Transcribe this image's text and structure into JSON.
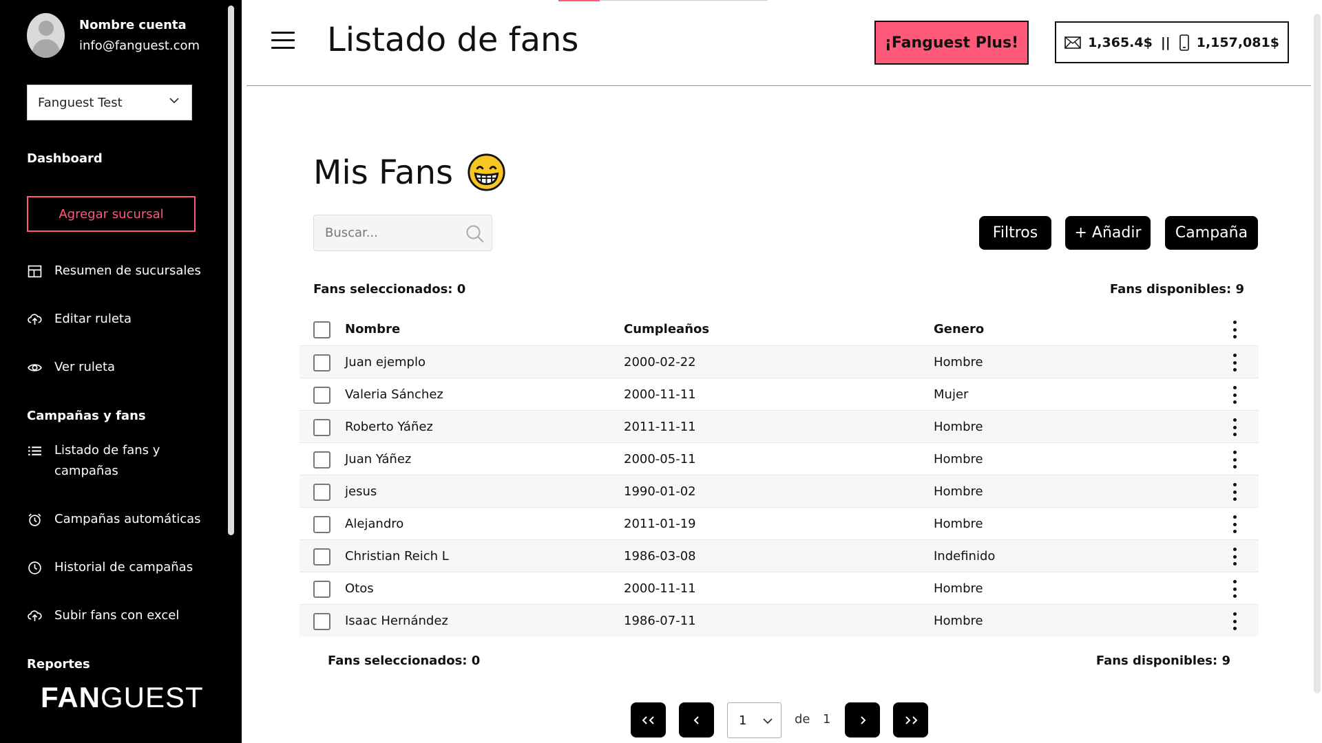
{
  "account": {
    "name": "Nombre cuenta",
    "email": "info@fanguest.com"
  },
  "branch_selector": {
    "value": "Fanguest Test"
  },
  "sidebar": {
    "dashboard_title": "Dashboard",
    "add_branch": "Agregar sucursal",
    "items_top": [
      {
        "label": "Resumen de sucursales",
        "icon": "layout-icon"
      },
      {
        "label": "Editar ruleta",
        "icon": "cloud-upload-icon"
      },
      {
        "label": "Ver ruleta",
        "icon": "eye-icon"
      }
    ],
    "campaigns_title": "Campañas y fans",
    "items_campaigns": [
      {
        "label": "Listado de fans y campañas",
        "icon": "list-icon"
      },
      {
        "label": "Campañas automáticas",
        "icon": "alarm-icon"
      },
      {
        "label": "Historial de campañas",
        "icon": "clock-icon"
      },
      {
        "label": "Subir fans con excel",
        "icon": "cloud-upload-icon"
      }
    ],
    "reports_title": "Reportes",
    "logo_bold": "FAN",
    "logo_light": "GUEST"
  },
  "header": {
    "title": "Listado de fans",
    "plus_button": "¡Fanguest Plus!",
    "email_balance": "1,365.4$",
    "separator": "||",
    "sms_balance": "1,157,081$"
  },
  "main": {
    "title": "Mis Fans",
    "emoji_icon": "grinning-face-icon",
    "search_placeholder": "Buscar...",
    "buttons": {
      "filters": "Filtros",
      "add": "+ Añadir",
      "campaign": "Campaña"
    },
    "selected_label": "Fans seleccionados: 0",
    "available_label": "Fans disponibles: 9",
    "columns": {
      "name": "Nombre",
      "birthday": "Cumpleaños",
      "gender": "Genero"
    },
    "rows": [
      {
        "name": "Juan ejemplo",
        "birthday": "2000-02-22",
        "gender": "Hombre"
      },
      {
        "name": "Valeria Sánchez",
        "birthday": "2000-11-11",
        "gender": "Mujer"
      },
      {
        "name": "Roberto Yáñez",
        "birthday": "2011-11-11",
        "gender": "Hombre"
      },
      {
        "name": "Juan Yáñez",
        "birthday": "2000-05-11",
        "gender": "Hombre"
      },
      {
        "name": "jesus",
        "birthday": "1990-01-02",
        "gender": "Hombre"
      },
      {
        "name": "Alejandro",
        "birthday": "2011-01-19",
        "gender": "Hombre"
      },
      {
        "name": "Christian Reich L",
        "birthday": "1986-03-08",
        "gender": "Indefinido"
      },
      {
        "name": "Otos",
        "birthday": "2000-11-11",
        "gender": "Hombre"
      },
      {
        "name": "Isaac Hernández",
        "birthday": "1986-07-11",
        "gender": "Hombre"
      }
    ],
    "pagination": {
      "current": "1",
      "of_label": "de",
      "total": "1"
    }
  },
  "colors": {
    "accent": "#ff5a7a",
    "sidebar_bg": "#000000"
  }
}
